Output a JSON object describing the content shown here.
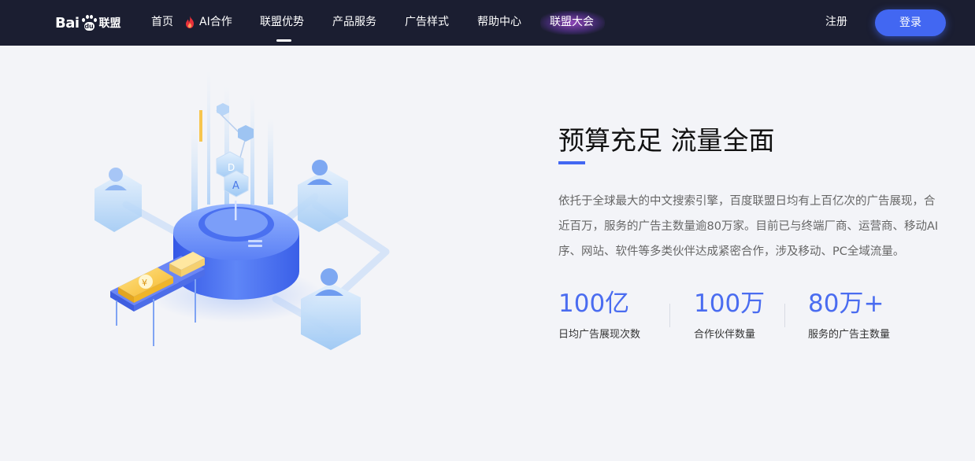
{
  "nav": {
    "logo_bai": "Bai",
    "logo_du": "du",
    "logo_suffix": "联盟",
    "items": [
      {
        "label": "首页"
      },
      {
        "label": "AI合作"
      },
      {
        "label": "联盟优势"
      },
      {
        "label": "产品服务"
      },
      {
        "label": "广告样式"
      },
      {
        "label": "帮助中心"
      },
      {
        "label": "联盟大会"
      }
    ],
    "register": "注册",
    "login": "登录"
  },
  "hero": {
    "title": "预算充足 流量全面",
    "desc_lines": [
      "依托于全球最大的中文搜索引擎，百度联盟日均有上百亿次的广告展现，合",
      "近百万，服务的广告主数量逾80万家。目前已与终端厂商、运营商、移动AI",
      "序、网站、软件等多类伙伴达成紧密合作，涉及移动、PC全域流量。"
    ],
    "stats": [
      {
        "value": "100亿",
        "label": "日均广告展现次数"
      },
      {
        "value": "100万",
        "label": "合作伙伴数量"
      },
      {
        "value": "80万+",
        "label": "服务的广告主数量"
      }
    ]
  },
  "illustration": {
    "cube_letters": [
      "D",
      "A"
    ],
    "yen_symbol": "¥"
  },
  "colors": {
    "nav_bg": "#1b1e31",
    "accent": "#4267f2",
    "stat_blue": "#4a6cf0",
    "page_bg": "#f3f4f8"
  }
}
